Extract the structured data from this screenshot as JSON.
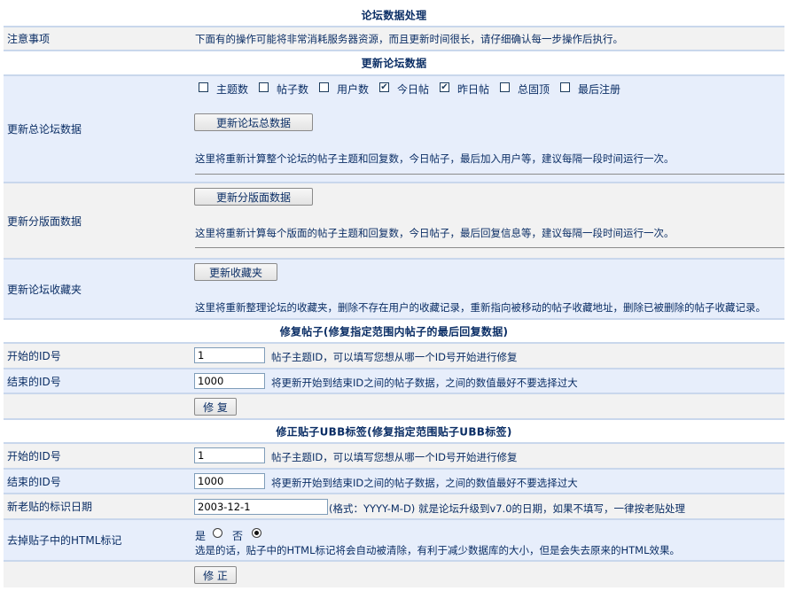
{
  "page": {
    "title": "论坛数据处理",
    "notice_label": "注意事项",
    "notice_text": "下面有的操作可能将非常消耗服务器资源，而且更新时间很长，请仔细确认每一步操作后执行。"
  },
  "update_section": {
    "title": "更新论坛数据",
    "total": {
      "label": "更新总论坛数据",
      "checkboxes": [
        {
          "label": "主题数",
          "checked": false
        },
        {
          "label": "帖子数",
          "checked": false
        },
        {
          "label": "用户数",
          "checked": false
        },
        {
          "label": "今日帖",
          "checked": true
        },
        {
          "label": "昨日帖",
          "checked": true
        },
        {
          "label": "总固顶",
          "checked": false
        },
        {
          "label": "最后注册",
          "checked": false
        }
      ],
      "button": "更新论坛总数据",
      "desc": "这里将重新计算整个论坛的帖子主题和回复数，今日帖子，最后加入用户等，建议每隔一段时间运行一次。"
    },
    "boards": {
      "label": "更新分版面数据",
      "button": "更新分版面数据",
      "desc": "这里将重新计算每个版面的帖子主题和回复数，今日帖子，最后回复信息等，建议每隔一段时间运行一次。"
    },
    "favorites": {
      "label": "更新论坛收藏夹",
      "button": "更新收藏夹",
      "desc": "这里将重新整理论坛的收藏夹，删除不存在用户的收藏记录，重新指向被移动的帖子收藏地址，删除已被删除的帖子收藏记录。"
    }
  },
  "fix_section": {
    "title": "修复帖子(修复指定范围内帖子的最后回复数据)",
    "start_label": "开始的ID号",
    "start_value": "1",
    "start_hint": "帖子主题ID，可以填写您想从哪一个ID号开始进行修复",
    "end_label": "结束的ID号",
    "end_value": "1000",
    "end_hint": "将更新开始到结束ID之间的帖子数据，之间的数值最好不要选择过大",
    "button": "修 复"
  },
  "ubb_section": {
    "title": "修正贴子UBB标签(修复指定范围贴子UBB标签)",
    "start_label": "开始的ID号",
    "start_value": "1",
    "start_hint": "帖子主题ID，可以填写您想从哪一个ID号开始进行修复",
    "end_label": "结束的ID号",
    "end_value": "1000",
    "end_hint": "将更新开始到结束ID之间的帖子数据，之间的数值最好不要选择过大",
    "date_label": "新老贴的标识日期",
    "date_value": "2003-12-1",
    "date_hint": "(格式：YYYY-M-D) 就是论坛升级到v7.0的日期，如果不填写，一律按老贴处理",
    "html_label": "去掉贴子中的HTML标记",
    "yes_label": "是",
    "no_label": "否",
    "html_selected": "no",
    "html_hint": "选是的话，贴子中的HTML标记将会自动被清除，有利于减少数据库的大小，但是会失去原来的HTML效果。",
    "button": "修 正"
  }
}
